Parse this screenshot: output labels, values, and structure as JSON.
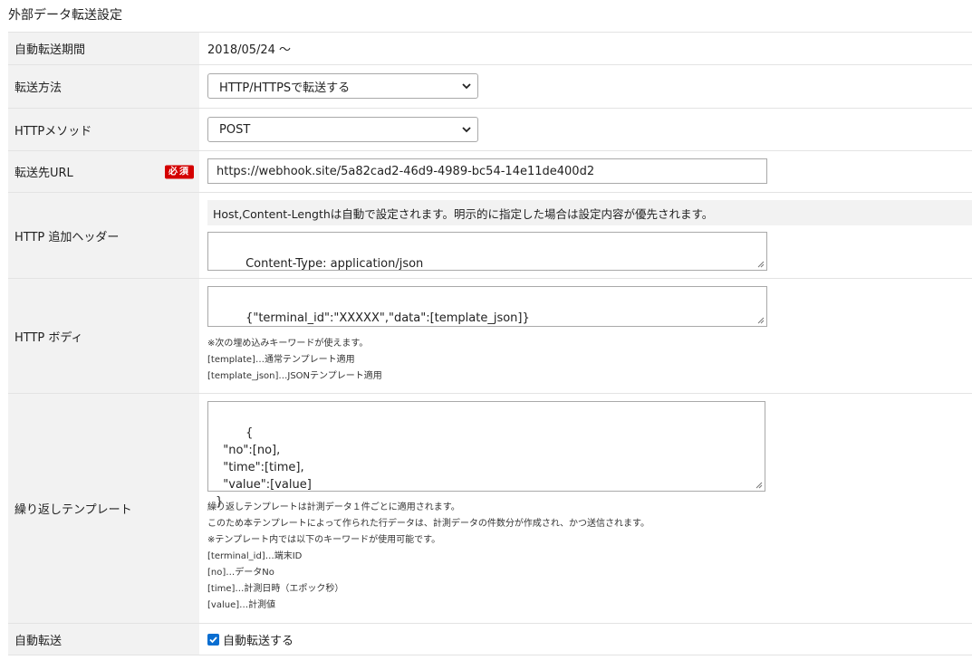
{
  "page": {
    "title": "外部データ転送設定"
  },
  "rows": {
    "period": {
      "label": "自動転送期間",
      "value": "2018/05/24 ～"
    },
    "method": {
      "label": "転送方法",
      "selected": "HTTP/HTTPSで転送する"
    },
    "http_method": {
      "label": "HTTPメソッド",
      "selected": "POST"
    },
    "url": {
      "label": "転送先URL",
      "badge": "必須",
      "value": "https://webhook.site/5a82cad2-46d9-4989-bc54-14e11de400d2"
    },
    "headers": {
      "label": "HTTP 追加ヘッダー",
      "notice": "Host,Content-Lengthは自動で設定されます。明示的に指定した場合は設定内容が優先されます。",
      "value": "Content-Type: application/json"
    },
    "body": {
      "label": "HTTP ボディ",
      "value": "{\"terminal_id\":\"XXXXX\",\"data\":[template_json]}",
      "help": [
        "※次の埋め込みキーワードが使えます。",
        "[template]…通常テンプレート適用",
        "[template_json]…JSONテンプレート適用"
      ]
    },
    "repeat": {
      "label": "繰り返しテンプレート",
      "value": "{\n  \"no\":[no],\n  \"time\":[time],\n  \"value\":[value]\n}",
      "help": [
        "繰り返しテンプレートは計測データ１件ごとに適用されます。",
        "このため本テンプレートによって作られた行データは、計測データの件数分が作成され、かつ送信されます。",
        "※テンプレート内では以下のキーワードが使用可能です。",
        "[terminal_id]…端末ID",
        "[no]…データNo",
        "[time]…計測日時（エポック秒）",
        "[value]…計測値"
      ]
    },
    "auto": {
      "label": "自動転送",
      "checkbox_label": "自動転送する",
      "checked": true
    }
  },
  "colors": {
    "accent": "#0a6ed1",
    "required": "#d40000",
    "label_bg": "#f2f2f2"
  }
}
